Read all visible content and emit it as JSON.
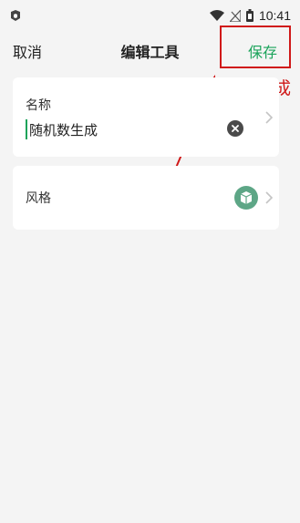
{
  "statusbar": {
    "time": "10:41"
  },
  "header": {
    "cancel_label": "取消",
    "title": "编辑工具",
    "save_label": "保存"
  },
  "annotation": {
    "text": "点击完成",
    "color": "#d01818"
  },
  "form": {
    "name_label": "名称",
    "name_value": "随机数生成",
    "style_label": "风格"
  },
  "colors": {
    "accent": "#1aa35a",
    "badge": "#5da686"
  },
  "icons": [
    "app-icon",
    "wifi-icon",
    "no-signal-icon",
    "battery-icon",
    "clear-icon",
    "chevron-right-icon",
    "cube-icon",
    "red-arrow"
  ]
}
